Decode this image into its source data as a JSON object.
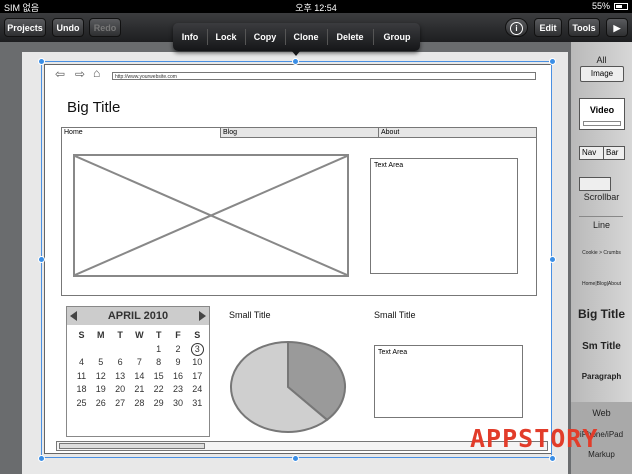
{
  "status": {
    "carrier": "SIM 없음",
    "time": "오후 12:54",
    "battery": "55%"
  },
  "toolbar": {
    "projects": "Projects",
    "undo": "Undo",
    "redo": "Redo",
    "info_symbol": "i",
    "edit": "Edit",
    "tools": "Tools",
    "play_symbol": "▶"
  },
  "popup": {
    "items": [
      "Info",
      "Lock",
      "Copy",
      "Clone",
      "Delete",
      "Group"
    ]
  },
  "browser": {
    "url": "http://www.yourwebsite.com",
    "back_symbol": "⇦",
    "forward_symbol": "⇨",
    "home_symbol": "⌂"
  },
  "page": {
    "big_title": "Big Title",
    "tabs": [
      "Home",
      "Blog",
      "About"
    ],
    "text_area_1": "Text Area",
    "text_area_2": "Text Area",
    "small_title_1": "Small Title",
    "small_title_2": "Small Title"
  },
  "calendar": {
    "month": "APRIL 2010",
    "weekdays": [
      "S",
      "M",
      "T",
      "W",
      "T",
      "F",
      "S"
    ],
    "days": [
      "",
      "",
      "",
      "",
      "1",
      "2",
      "3",
      "4",
      "5",
      "6",
      "7",
      "8",
      "9",
      "10",
      "11",
      "12",
      "13",
      "14",
      "15",
      "16",
      "17",
      "18",
      "19",
      "20",
      "21",
      "22",
      "23",
      "24",
      "25",
      "26",
      "27",
      "28",
      "29",
      "30",
      "31"
    ],
    "highlighted": "3"
  },
  "pie": {
    "slices": [
      0.38,
      0.62
    ],
    "colors": [
      "#9a9a9a",
      "#cfcfcf"
    ]
  },
  "panel": {
    "all": "All",
    "image": "Image",
    "video": "Video",
    "nav": "Nav",
    "bar": "Bar",
    "scrollbar": "Scrollbar",
    "line": "Line",
    "cookie_crumbs": "Cookie > Crumbs",
    "home_blog_about": "Home|Blog|About",
    "big_title": "Big Title",
    "sm_title": "Sm Title",
    "paragraph": "Paragraph",
    "web": "Web",
    "iphone_ipad": "iPhone/iPad",
    "markup": "Markup"
  },
  "watermark": "APPSTORY",
  "colors": {
    "selection": "#3a8ee6",
    "watermark": "#e23c2a"
  }
}
